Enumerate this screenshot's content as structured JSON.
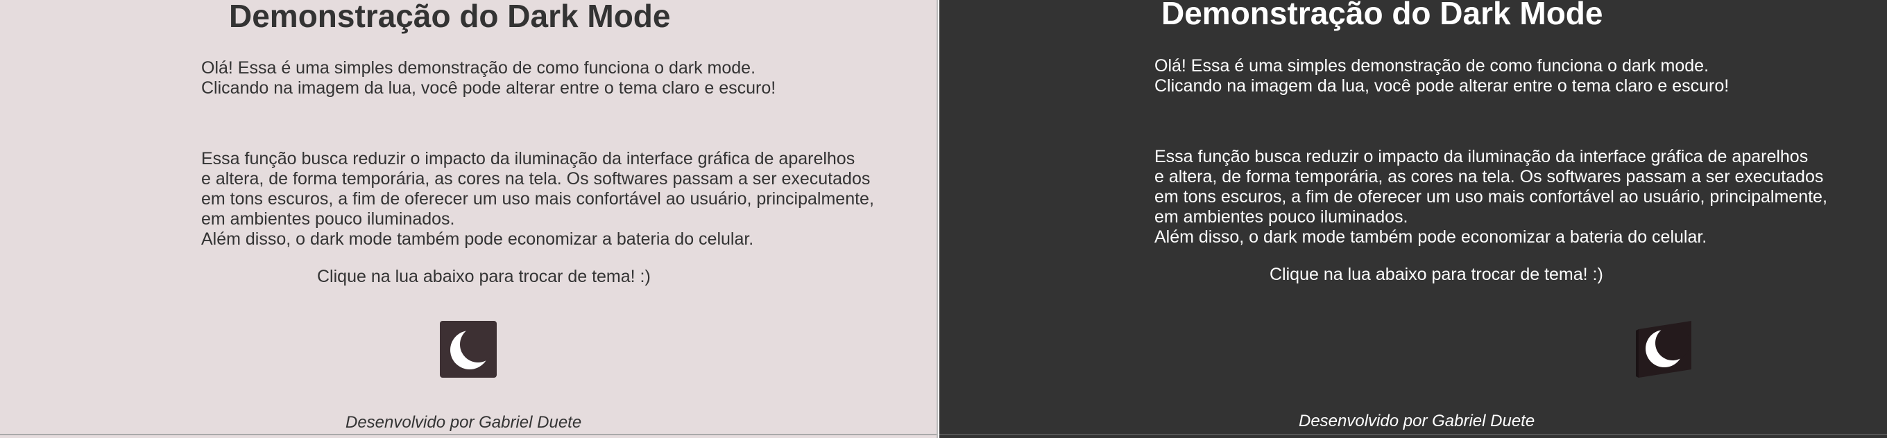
{
  "light_panel": {
    "theme": "light",
    "background": "#e5dcdd",
    "text_color": "#333333",
    "title": "Demonstração do Dark Mode",
    "intro": [
      "Olá! Essa é uma simples demonstração de como funciona o dark mode.",
      "Clicando na imagem da lua, você pode alterar entre o tema claro e escuro!"
    ],
    "description": [
      "Essa função busca reduzir o impacto da iluminação da interface gráfica de aparelhos",
      "e altera, de forma temporária, as cores na tela. Os softwares passam a ser executados",
      "em tons escuros, a fim de oferecer um uso mais confortável ao usuário, principalmente,",
      "em ambientes pouco iluminados.",
      "Além disso, o dark mode também pode economizar a bateria do celular."
    ],
    "cta": "Clique na lua abaixo para trocar de tema! :)",
    "toggle_icon": "crescent-moon-icon",
    "footer": "Desenvolvido por Gabriel Duete"
  },
  "dark_panel": {
    "theme": "dark",
    "background": "#333333",
    "text_color": "#ffffff",
    "title": "Demonstração do Dark Mode",
    "intro": [
      "Olá! Essa é uma simples demonstração de como funciona o dark mode.",
      "Clicando na imagem da lua, você pode alterar entre o tema claro e escuro!"
    ],
    "description": [
      "Essa função busca reduzir o impacto da iluminação da interface gráfica de aparelhos",
      "e altera, de forma temporária, as cores na tela. Os softwares passam a ser executados",
      "em tons escuros, a fim de oferecer um uso mais confortável ao usuário, principalmente,",
      "em ambientes pouco iluminados.",
      "Além disso, o dark mode também pode economizar a bateria do celular."
    ],
    "cta": "Clique na lua abaixo para trocar de tema! :)",
    "toggle_icon": "crescent-moon-icon",
    "footer": "Desenvolvido por Gabriel Duete"
  }
}
